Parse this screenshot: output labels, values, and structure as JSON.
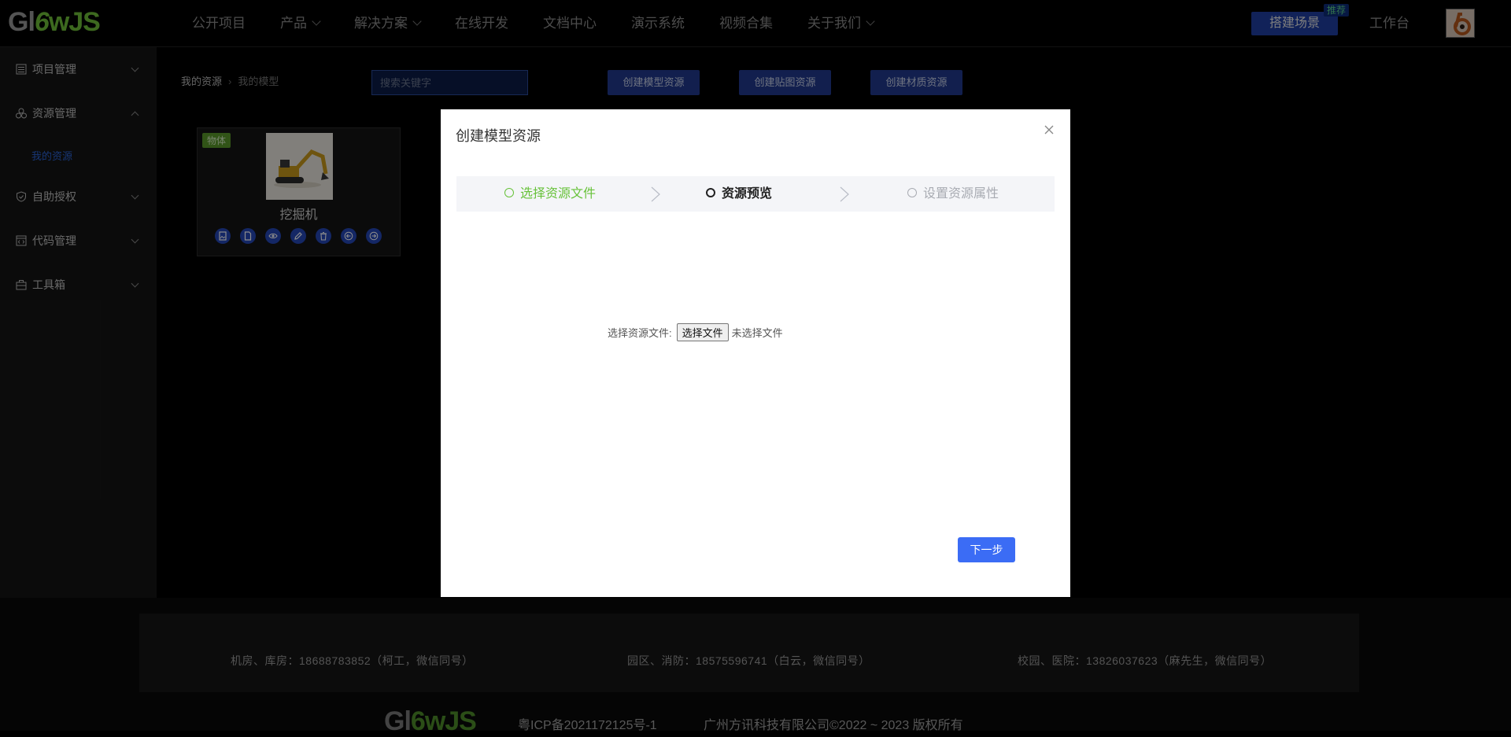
{
  "header": {
    "logo_prefix": "Gl",
    "logo_mid": "6",
    "logo_suffix": "wJS",
    "nav": [
      {
        "label": "公开项目",
        "dropdown": false
      },
      {
        "label": "产品",
        "dropdown": true
      },
      {
        "label": "解决方案",
        "dropdown": true
      },
      {
        "label": "在线开发",
        "dropdown": false
      },
      {
        "label": "文档中心",
        "dropdown": false
      },
      {
        "label": "演示系统",
        "dropdown": false
      },
      {
        "label": "视频合集",
        "dropdown": false
      },
      {
        "label": "关于我们",
        "dropdown": true
      }
    ],
    "build_button": "搭建场景",
    "build_badge": "推荐",
    "workbench": "工作台",
    "accent": "#1f3ea3"
  },
  "sidebar": {
    "items": [
      {
        "label": "项目管理",
        "icon": "list-icon",
        "expanded": false
      },
      {
        "label": "资源管理",
        "icon": "cubes-icon",
        "expanded": true
      },
      {
        "label": "自助授权",
        "icon": "shield-icon",
        "expanded": false
      },
      {
        "label": "代码管理",
        "icon": "code-icon",
        "expanded": false
      },
      {
        "label": "工具箱",
        "icon": "toolbox-icon",
        "expanded": false
      }
    ],
    "sub_item": "我的资源"
  },
  "toolbar": {
    "breadcrumb": [
      "我的资源",
      "我的模型"
    ],
    "search_placeholder": "搜索关键字",
    "buttons": [
      "创建模型资源",
      "创建贴图资源",
      "创建材质资源"
    ]
  },
  "card": {
    "tag": "物体",
    "title": "挖掘机",
    "actions": [
      "file-image-icon",
      "file-icon",
      "eye-icon",
      "edit-icon",
      "trash-icon",
      "arrow-left-icon",
      "arrow-right-icon"
    ]
  },
  "modal": {
    "title": "创建模型资源",
    "steps": [
      {
        "label": "选择资源文件",
        "status": "finished",
        "color": "#67c23a"
      },
      {
        "label": "资源预览",
        "status": "current",
        "color": "#222222"
      },
      {
        "label": "设置资源属性",
        "status": "waiting",
        "color": "#a8abb2"
      }
    ],
    "file_label": "选择资源文件:",
    "file_button": "选择文件",
    "file_status": "未选择文件",
    "next_button": "下一步",
    "next_color": "#3b6cf5"
  },
  "footer": {
    "contacts": [
      "机房、库房：18688783852（柯工，微信同号）",
      "园区、消防：18575596741（白云，微信同号）",
      "校园、医院：13826037623（麻先生，微信同号）"
    ],
    "icp": "粤ICP备2021172125号-1",
    "copyright": "广州方讯科技有限公司©2022 ~ 2023  版权所有"
  }
}
